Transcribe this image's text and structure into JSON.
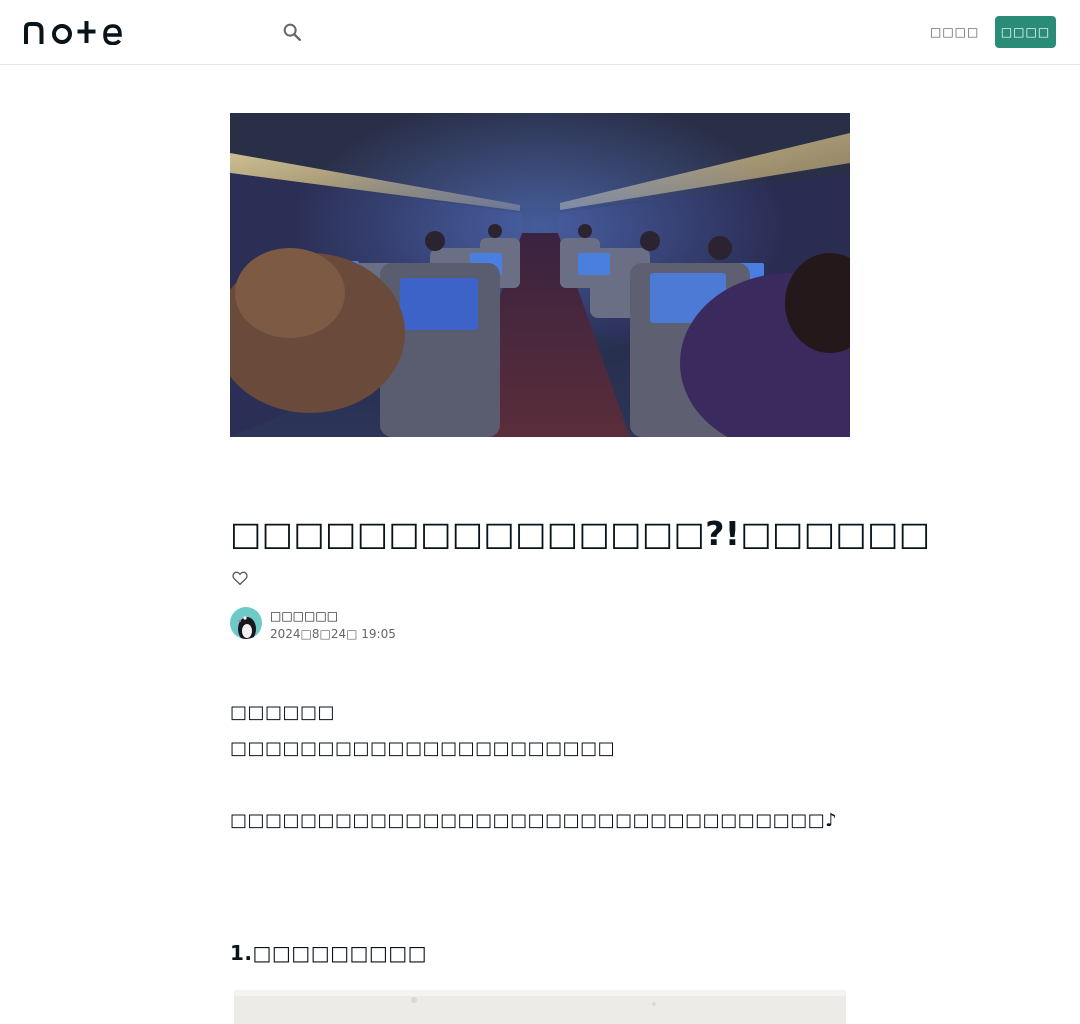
{
  "header": {
    "logo_text": "note",
    "search_icon": "search-icon",
    "login_label": "□□□□",
    "signup_label": "□□□□"
  },
  "article": {
    "hero_image": "airplane cabin interior photo",
    "title": "□□□□□□□□□□□□□□□?!□□□□□□",
    "like_icon": "heart-outline-icon",
    "author": {
      "avatar": "penguin avatar",
      "name": "□□□□□□",
      "date": "2024□8□24□ 19:05"
    },
    "paragraphs": [
      "□□□□□□",
      "□□□□□□□□□□□□□□□□□□□□□□",
      "□□□□□□□□□□□□□□□□□□□□□□□□□□□□□□□□□□♪"
    ],
    "section_heading": "1.□□□□□□□□□",
    "content_image": "section photo (cropped)"
  },
  "colors": {
    "accent": "#2a8c76",
    "text": "#08131a",
    "muted": "#666666",
    "border": "#e6e6e6"
  }
}
